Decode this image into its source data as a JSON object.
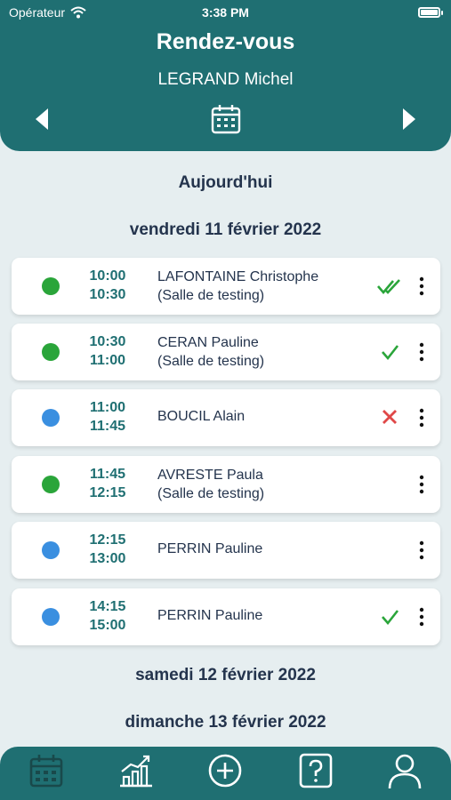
{
  "status_bar": {
    "carrier": "Opérateur",
    "time": "3:38 PM"
  },
  "header": {
    "title": "Rendez-vous",
    "subtitle": "LEGRAND Michel"
  },
  "today_label": "Aujourd'hui",
  "days": [
    {
      "label": "vendredi 11 février 2022",
      "appointments": [
        {
          "start": "10:00",
          "end": "10:30",
          "name": "LAFONTAINE Christophe",
          "room": "(Salle de testing)",
          "dot_color": "#2aa53a",
          "status": "double-check-icon"
        },
        {
          "start": "10:30",
          "end": "11:00",
          "name": "CERAN Pauline",
          "room": "(Salle de testing)",
          "dot_color": "#2aa53a",
          "status": "check-icon"
        },
        {
          "start": "11:00",
          "end": "11:45",
          "name": "BOUCIL Alain",
          "room": "",
          "dot_color": "#3a8fe0",
          "status": "cross-icon"
        },
        {
          "start": "11:45",
          "end": "12:15",
          "name": "AVRESTE Paula",
          "room": "(Salle de testing)",
          "dot_color": "#2aa53a",
          "status": ""
        },
        {
          "start": "12:15",
          "end": "13:00",
          "name": "PERRIN Pauline",
          "room": "",
          "dot_color": "#3a8fe0",
          "status": ""
        },
        {
          "start": "14:15",
          "end": "15:00",
          "name": "PERRIN Pauline",
          "room": "",
          "dot_color": "#3a8fe0",
          "status": "check-icon"
        }
      ]
    },
    {
      "label": "samedi 12 février 2022",
      "appointments": []
    },
    {
      "label": "dimanche 13 février 2022",
      "appointments": []
    }
  ],
  "tabbar": {
    "items": [
      "calendar-icon",
      "stats-chart-icon",
      "add-circle-icon",
      "help-icon",
      "profile-icon"
    ]
  },
  "colors": {
    "primary": "#1f6f72",
    "background": "#e6eef0",
    "confirmed": "#2aa53a",
    "pending": "#3a8fe0",
    "cancelled": "#e04848"
  }
}
